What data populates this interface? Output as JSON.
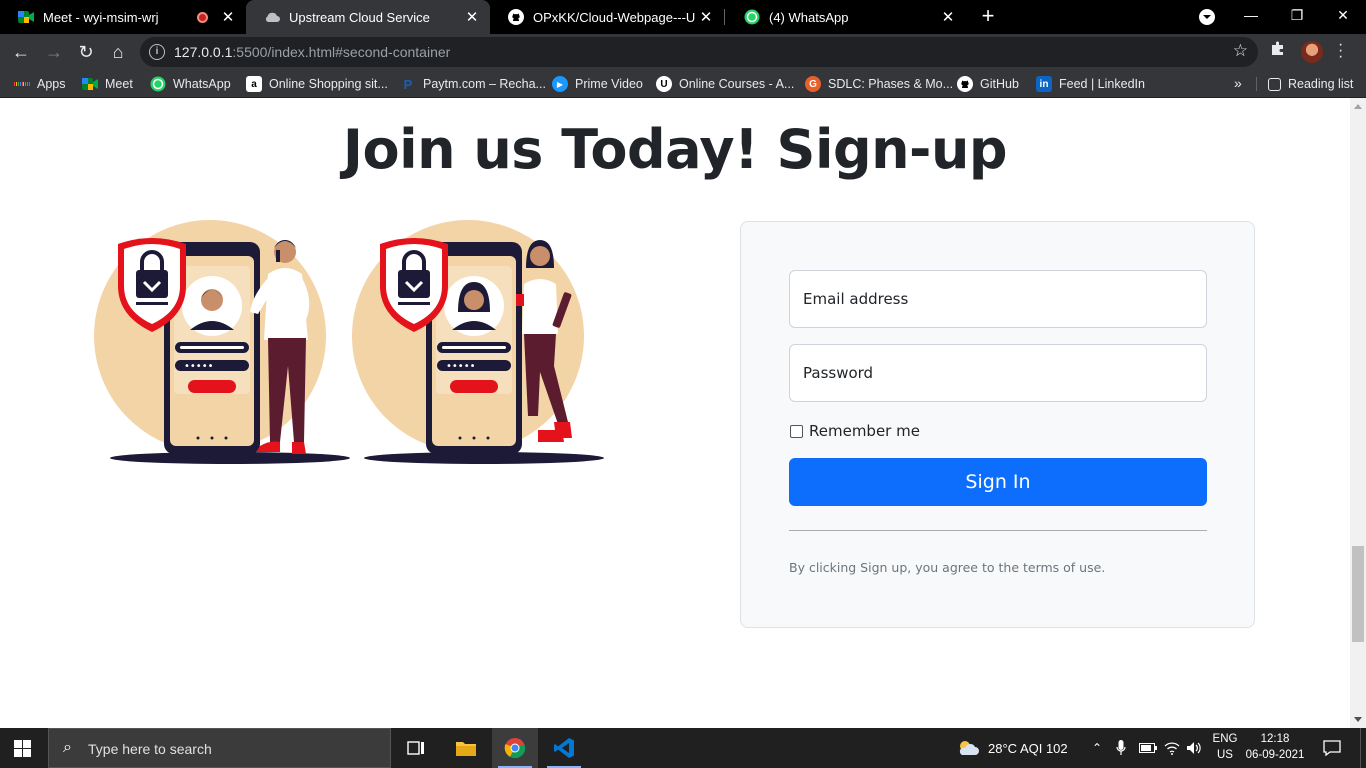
{
  "browser": {
    "tabs": [
      {
        "title": "Meet - wyi-msim-wrj",
        "recording": true
      },
      {
        "title": "Upstream Cloud Service",
        "active": true
      },
      {
        "title": "OPxKK/Cloud-Webpage---Upstre"
      },
      {
        "title": "(4) WhatsApp"
      }
    ],
    "url_host": "127.0.0.1",
    "url_rest": ":5500/index.html#second-container",
    "bookmarks": [
      {
        "label": "Apps",
        "icon": "apps-grid-icon"
      },
      {
        "label": "Meet",
        "icon": "google-meet-icon"
      },
      {
        "label": "WhatsApp",
        "icon": "whatsapp-icon"
      },
      {
        "label": "Online Shopping sit...",
        "icon": "amazon-icon"
      },
      {
        "label": "Paytm.com – Recha...",
        "icon": "paytm-icon"
      },
      {
        "label": "Prime Video",
        "icon": "prime-video-icon"
      },
      {
        "label": "Online Courses - A...",
        "icon": "udemy-icon"
      },
      {
        "label": "SDLC: Phases & Mo...",
        "icon": "sdlc-icon"
      },
      {
        "label": "GitHub",
        "icon": "github-icon"
      },
      {
        "label": "Feed | LinkedIn",
        "icon": "linkedin-icon"
      }
    ],
    "overflow_label": "»",
    "reading_list": "Reading list"
  },
  "page": {
    "heading": "Join us Today! Sign-up",
    "form": {
      "email_placeholder": "Email address",
      "password_placeholder": "Password",
      "remember_label": "Remember me",
      "remember_checked": false,
      "submit_label": "Sign In",
      "terms_text": "By clicking Sign up, you agree to the terms of use."
    },
    "colors": {
      "primary": "#0d6efd",
      "heading": "#212529",
      "card_bg": "#f8f9fa",
      "muted": "#6c757d"
    }
  },
  "taskbar": {
    "search_placeholder": "Type here to search",
    "weather": "28°C  AQI 102",
    "lang_top": "ENG",
    "lang_bottom": "US",
    "time": "12:18",
    "date": "06-09-2021"
  }
}
